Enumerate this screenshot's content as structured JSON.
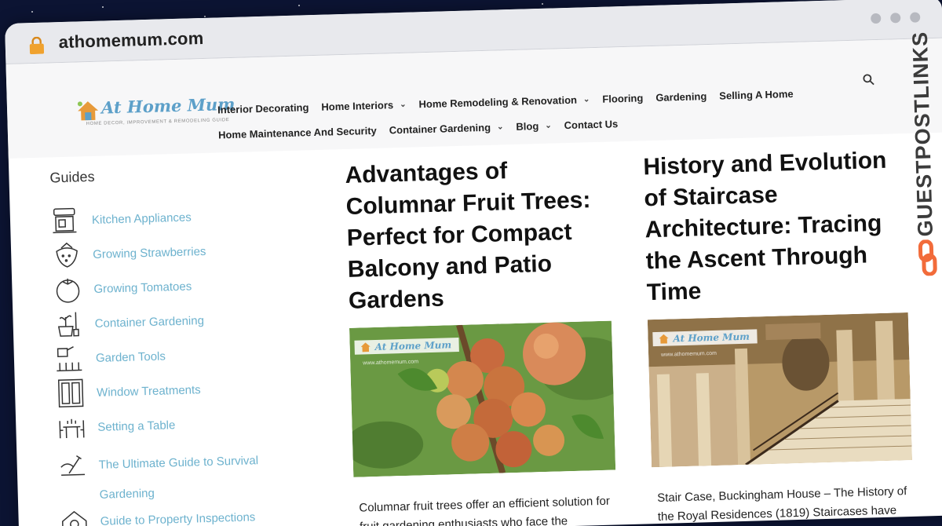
{
  "browser": {
    "url": "athomemum.com"
  },
  "site": {
    "logo_title": "At Home Mum",
    "logo_subtitle": "HOME DECOR, IMPROVEMENT & REMODELING GUIDE"
  },
  "nav": {
    "row1": [
      {
        "label": "Interior Decorating",
        "dropdown": false
      },
      {
        "label": "Home Interiors",
        "dropdown": true
      },
      {
        "label": "Home Remodeling & Renovation",
        "dropdown": true
      },
      {
        "label": "Flooring",
        "dropdown": false
      },
      {
        "label": "Gardening",
        "dropdown": false
      },
      {
        "label": "Selling A Home",
        "dropdown": false
      }
    ],
    "row2": [
      {
        "label": "Home Maintenance And Security",
        "dropdown": false
      },
      {
        "label": "Container Gardening",
        "dropdown": true
      },
      {
        "label": "Blog",
        "dropdown": true
      },
      {
        "label": "Contact Us",
        "dropdown": false
      }
    ]
  },
  "sidebar": {
    "title": "Guides",
    "items": [
      {
        "label": "Kitchen Appliances",
        "icon": "kitchen-appliance-icon"
      },
      {
        "label": "Growing Strawberries",
        "icon": "strawberry-icon"
      },
      {
        "label": "Growing Tomatoes",
        "icon": "tomato-icon"
      },
      {
        "label": "Container Gardening",
        "icon": "plant-pot-icon"
      },
      {
        "label": "Garden Tools",
        "icon": "watering-can-icon"
      },
      {
        "label": "Window Treatments",
        "icon": "window-icon"
      },
      {
        "label": "Setting a Table",
        "icon": "dining-table-icon"
      },
      {
        "label": "The Ultimate Guide to Survival Gardening",
        "icon": "survival-garden-icon"
      },
      {
        "label": "Guide to Property Inspections",
        "icon": "house-inspection-icon"
      }
    ]
  },
  "articles": [
    {
      "title": "Advantages of Columnar Fruit Trees: Perfect for Compact Balcony and Patio Gardens",
      "image_logo": "At Home Mum",
      "image_url": "www.athomemum.com",
      "excerpt": "Columnar fruit trees offer an efficient solution for fruit gardening enthusiasts who face the"
    },
    {
      "title": "History and Evolution of Staircase Architecture: Tracing the Ascent Through Time",
      "image_logo": "At Home Mum",
      "image_url": "www.athomemum.com",
      "excerpt": "Stair Case, Buckingham House – The History of the Royal Residences (1819) Staircases have been an integral architectural element"
    }
  ],
  "watermark": {
    "text": "GUESTPOSTLINKS"
  },
  "colors": {
    "background": "#0c1433",
    "link": "#6db2ce",
    "logo": "#5da0c9",
    "lock": "#f0a22e",
    "watermark_accent": "#f26b3a"
  }
}
